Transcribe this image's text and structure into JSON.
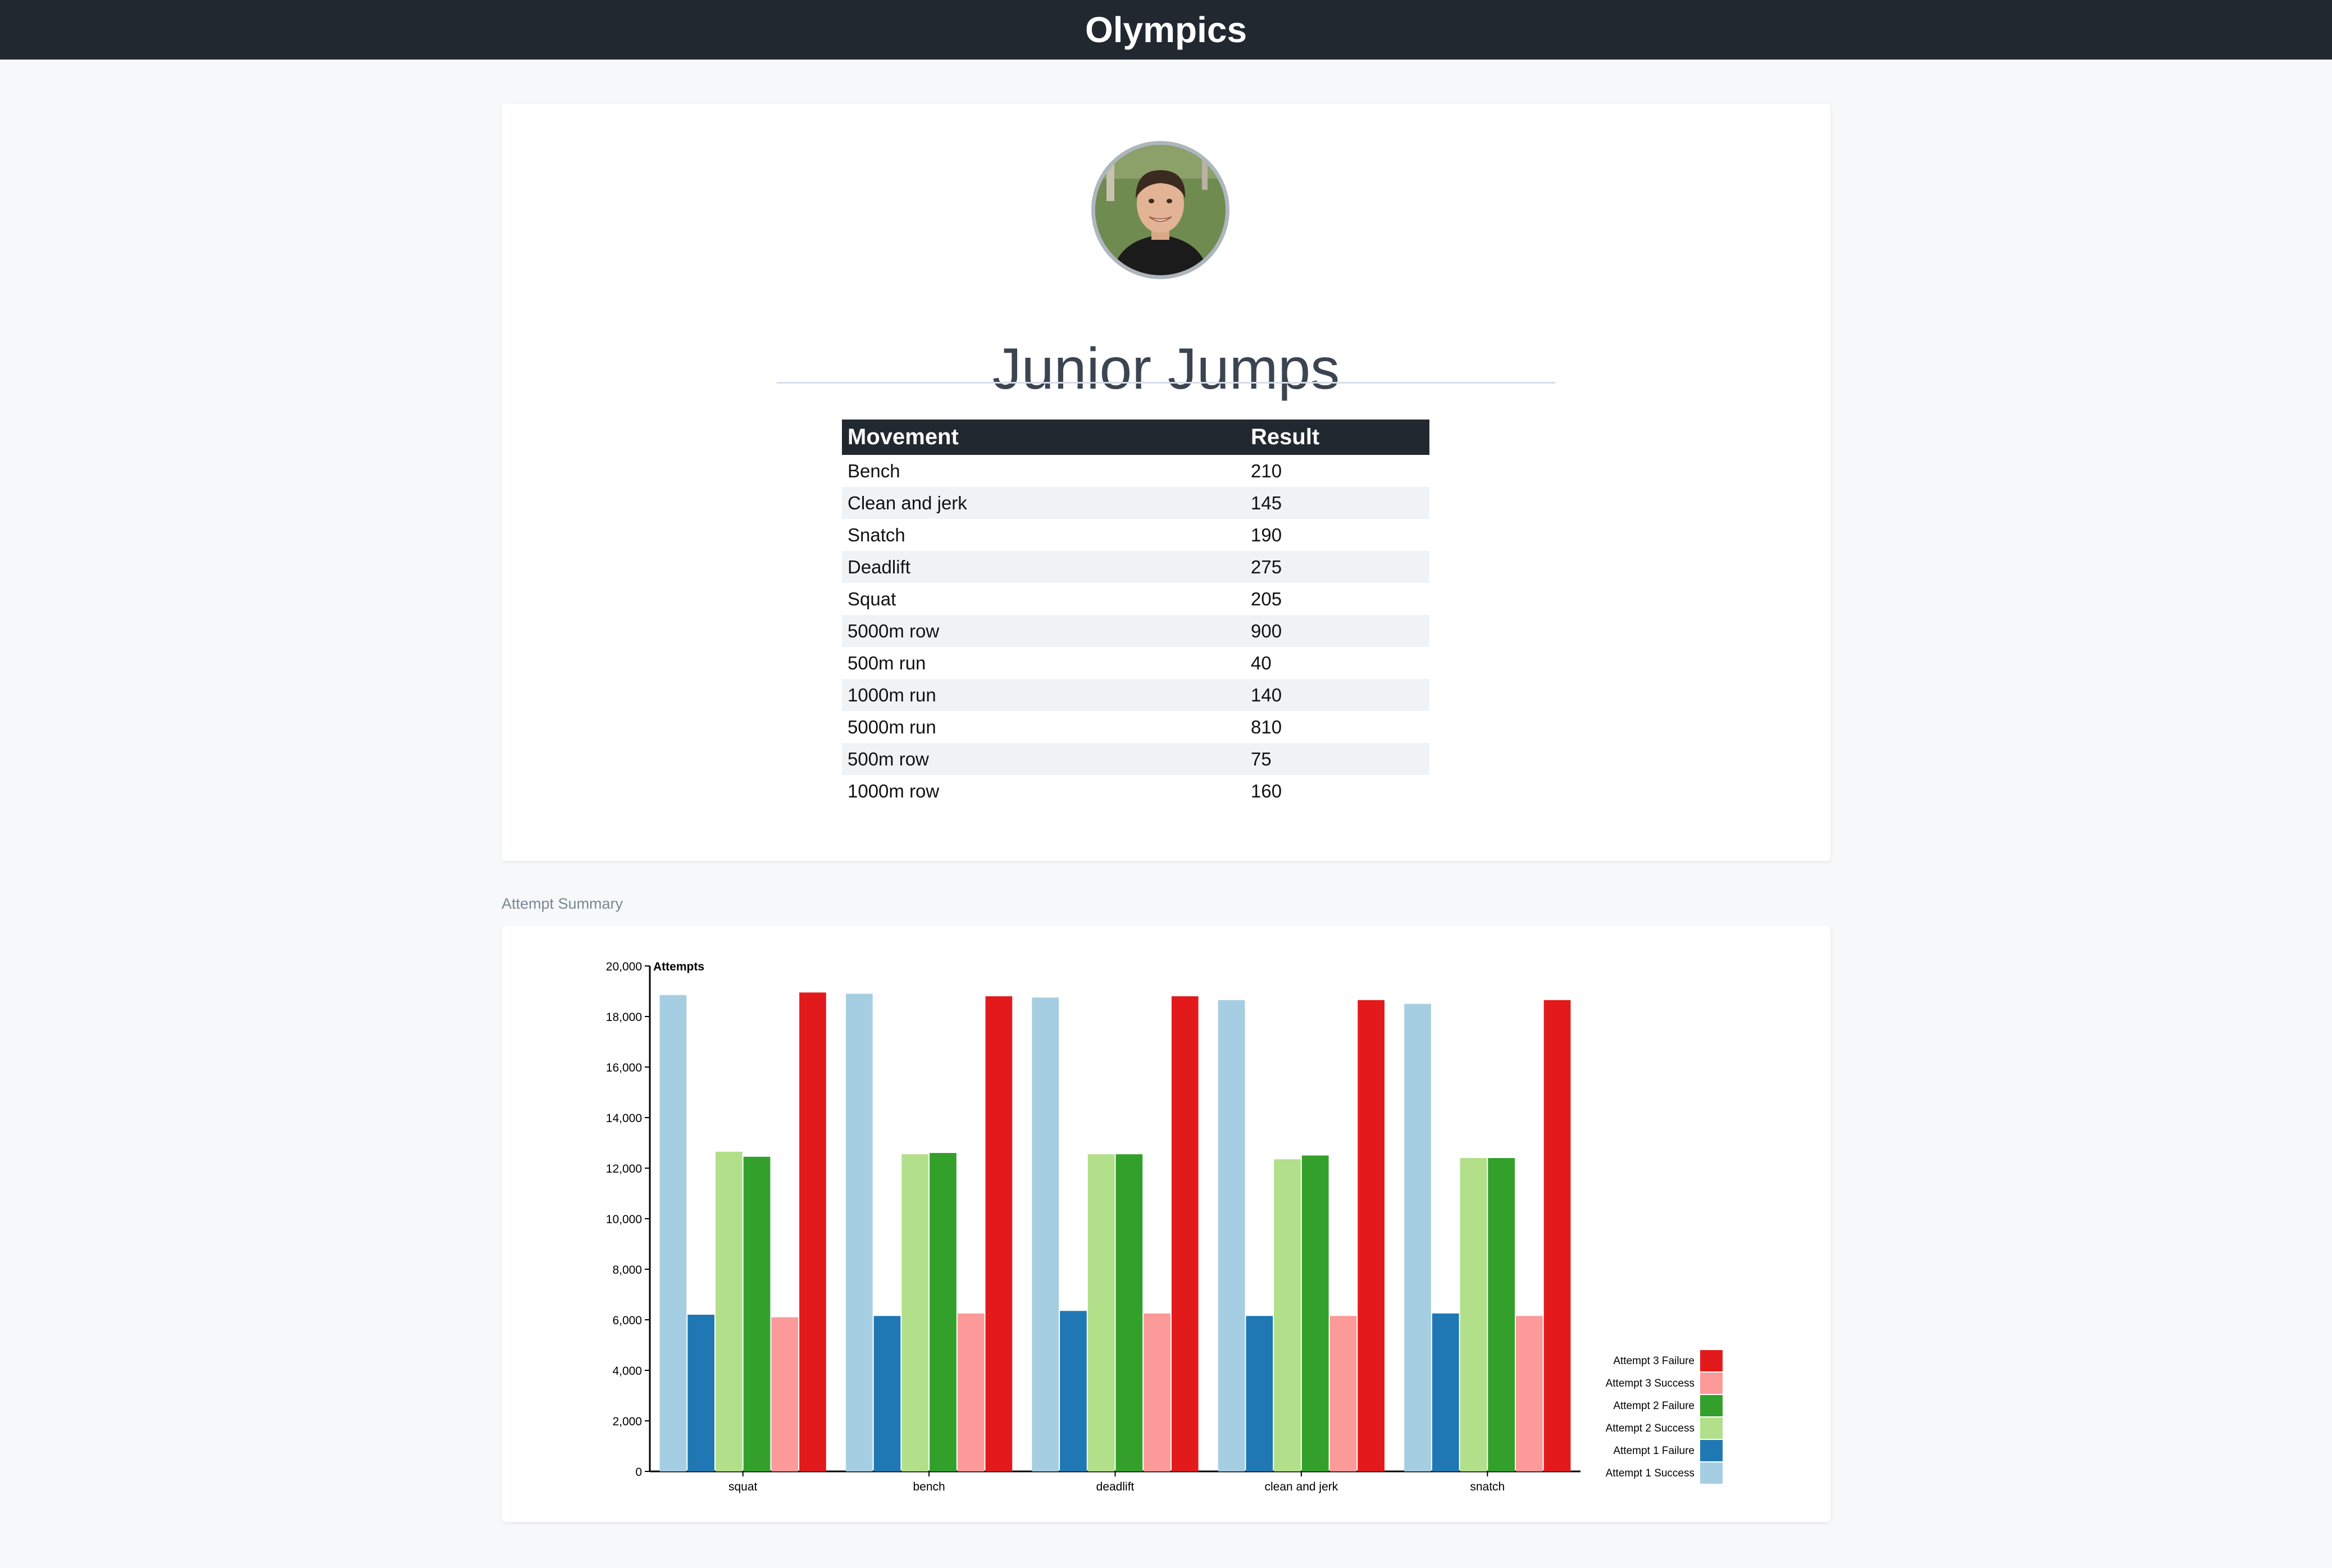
{
  "app": {
    "title": "Olympics"
  },
  "profile": {
    "name": "Junior Jumps",
    "avatar_alt": "avatar"
  },
  "table": {
    "headers": [
      "Movement",
      "Result"
    ],
    "rows": [
      [
        "Bench",
        "210"
      ],
      [
        "Clean and jerk",
        "145"
      ],
      [
        "Snatch",
        "190"
      ],
      [
        "Deadlift",
        "275"
      ],
      [
        "Squat",
        "205"
      ],
      [
        "5000m row",
        "900"
      ],
      [
        "500m run",
        "40"
      ],
      [
        "1000m run",
        "140"
      ],
      [
        "5000m run",
        "810"
      ],
      [
        "500m row",
        "75"
      ],
      [
        "1000m row",
        "160"
      ]
    ]
  },
  "section": {
    "attempt_summary_label": "Attempt Summary"
  },
  "chart_data": {
    "type": "bar",
    "title": "",
    "ylabel": "Attempts",
    "xlabel": "",
    "ylim": [
      0,
      20000
    ],
    "yticks": [
      0,
      2000,
      4000,
      6000,
      8000,
      10000,
      12000,
      14000,
      16000,
      18000,
      20000
    ],
    "grid": false,
    "legend": "right",
    "categories": [
      "squat",
      "bench",
      "deadlift",
      "clean and jerk",
      "snatch"
    ],
    "series": [
      {
        "name": "Attempt 1 Success",
        "color": "#a6cee3",
        "values": [
          18850,
          18900,
          18750,
          18650,
          18500
        ]
      },
      {
        "name": "Attempt 1 Failure",
        "color": "#1f78b4",
        "values": [
          6200,
          6150,
          6350,
          6150,
          6250
        ]
      },
      {
        "name": "Attempt 2 Success",
        "color": "#b2df8a",
        "values": [
          12650,
          12550,
          12550,
          12350,
          12400
        ]
      },
      {
        "name": "Attempt 2 Failure",
        "color": "#33a02c",
        "values": [
          12450,
          12600,
          12550,
          12500,
          12400
        ]
      },
      {
        "name": "Attempt 3 Success",
        "color": "#fb9a99",
        "values": [
          6100,
          6250,
          6250,
          6150,
          6150
        ]
      },
      {
        "name": "Attempt 3 Failure",
        "color": "#e31a1c",
        "values": [
          18950,
          18800,
          18800,
          18650,
          18650
        ]
      }
    ]
  }
}
